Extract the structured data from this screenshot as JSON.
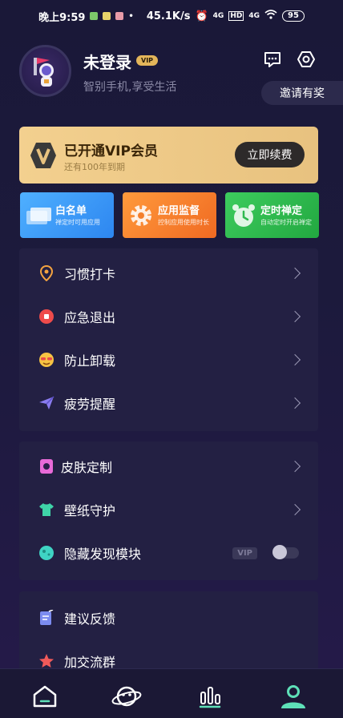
{
  "status_bar": {
    "time": "晚上9:59",
    "network_speed": "45.1K/s",
    "signal_1": "4G",
    "signal_2": "4G",
    "hd": "HD",
    "battery": "95"
  },
  "profile": {
    "username": "未登录",
    "vip_badge": "VIP",
    "tagline": "智别手机,享受生活",
    "icons": [
      "message-icon",
      "settings-hexagon-icon"
    ],
    "invite_label": "邀请有奖"
  },
  "vip_card": {
    "title": "已开通VIP会员",
    "subtitle": "还有100年到期",
    "button": "立即续费",
    "logo": "V"
  },
  "features": [
    {
      "title": "白名单",
      "subtitle": "禅定时可用应用",
      "color": "#3b9bf5"
    },
    {
      "title": "应用监督",
      "subtitle": "控制应用使用时长",
      "color": "#f47f2c"
    },
    {
      "title": "定时禅定",
      "subtitle": "自动定时开启禅定",
      "color": "#2fb94f"
    }
  ],
  "menu_group_1": [
    {
      "label": "习惯打卡",
      "icon": "location-pin-icon"
    },
    {
      "label": "应急退出",
      "icon": "stop-icon"
    },
    {
      "label": "防止卸载",
      "icon": "sunglasses-face-icon"
    },
    {
      "label": "疲劳提醒",
      "icon": "paper-plane-icon"
    }
  ],
  "menu_group_2": [
    {
      "label": "皮肤定制",
      "icon": "skin-icon"
    },
    {
      "label": "壁纸守护",
      "icon": "shirt-icon"
    },
    {
      "label": "隐藏发现模块",
      "icon": "planet-icon",
      "tag": "VIP",
      "toggle_on": false
    }
  ],
  "menu_group_3": [
    {
      "label": "建议反馈",
      "icon": "feedback-icon"
    },
    {
      "label": "加交流群",
      "icon": "star-icon"
    }
  ],
  "tabs": [
    {
      "name": "home",
      "icon": "home-icon"
    },
    {
      "name": "discover",
      "icon": "planet-face-icon"
    },
    {
      "name": "stats",
      "icon": "bar-chart-icon"
    },
    {
      "name": "profile",
      "icon": "user-icon",
      "active": true
    }
  ],
  "colors": {
    "background": "#1a1838",
    "card": "#232043",
    "vip_gold": "#f3d08f",
    "active_tab": "#5ee0b8"
  }
}
